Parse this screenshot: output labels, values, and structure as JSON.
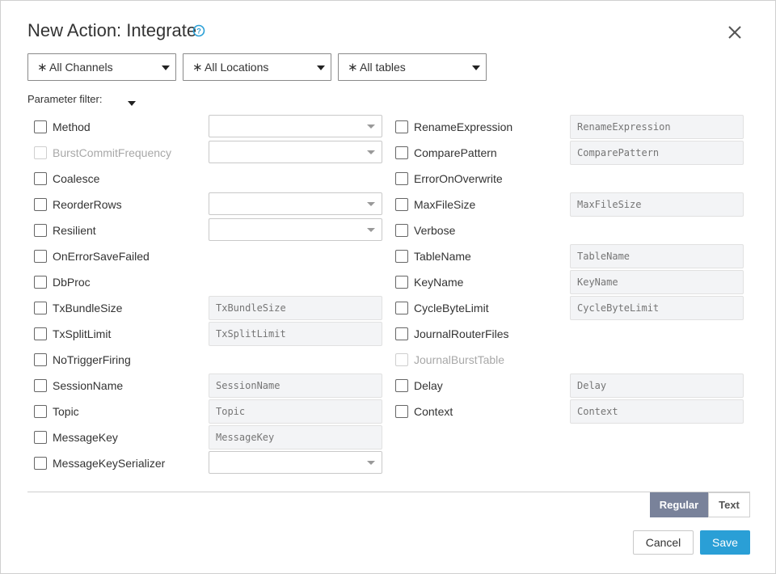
{
  "dialog": {
    "title": "New Action: Integrate",
    "help_icon": "help-circle-icon",
    "close_icon": "close-icon"
  },
  "filters": {
    "channels": "All Channels",
    "locations": "All Locations",
    "tables": "All tables",
    "star_glyph": "∗"
  },
  "parameter_filter": {
    "label": "Parameter filter:"
  },
  "left_params": [
    {
      "label": "Method",
      "control": "select",
      "disabled": false
    },
    {
      "label": "BurstCommitFrequency",
      "control": "select",
      "disabled": true
    },
    {
      "label": "Coalesce",
      "control": "none",
      "disabled": false
    },
    {
      "label": "ReorderRows",
      "control": "select",
      "disabled": false
    },
    {
      "label": "Resilient",
      "control": "select",
      "disabled": false
    },
    {
      "label": "OnErrorSaveFailed",
      "control": "none",
      "disabled": false
    },
    {
      "label": "DbProc",
      "control": "none",
      "disabled": false
    },
    {
      "label": "TxBundleSize",
      "control": "text",
      "placeholder": "TxBundleSize",
      "disabled": false
    },
    {
      "label": "TxSplitLimit",
      "control": "text",
      "placeholder": "TxSplitLimit",
      "disabled": false
    },
    {
      "label": "NoTriggerFiring",
      "control": "none",
      "disabled": false
    },
    {
      "label": "SessionName",
      "control": "text",
      "placeholder": "SessionName",
      "disabled": false
    },
    {
      "label": "Topic",
      "control": "text",
      "placeholder": "Topic",
      "disabled": false
    },
    {
      "label": "MessageKey",
      "control": "text",
      "placeholder": "MessageKey",
      "disabled": false
    },
    {
      "label": "MessageKeySerializer",
      "control": "select",
      "disabled": false
    }
  ],
  "right_params": [
    {
      "label": "RenameExpression",
      "control": "text",
      "placeholder": "RenameExpression",
      "disabled": false
    },
    {
      "label": "ComparePattern",
      "control": "text",
      "placeholder": "ComparePattern",
      "disabled": false
    },
    {
      "label": "ErrorOnOverwrite",
      "control": "none",
      "disabled": false
    },
    {
      "label": "MaxFileSize",
      "control": "text",
      "placeholder": "MaxFileSize",
      "disabled": false
    },
    {
      "label": "Verbose",
      "control": "none",
      "disabled": false
    },
    {
      "label": "TableName",
      "control": "text",
      "placeholder": "TableName",
      "disabled": false
    },
    {
      "label": "KeyName",
      "control": "text",
      "placeholder": "KeyName",
      "disabled": false
    },
    {
      "label": "CycleByteLimit",
      "control": "text",
      "placeholder": "CycleByteLimit",
      "disabled": false
    },
    {
      "label": "JournalRouterFiles",
      "control": "none",
      "disabled": false
    },
    {
      "label": "JournalBurstTable",
      "control": "none",
      "disabled": true
    },
    {
      "label": "Delay",
      "control": "text",
      "placeholder": "Delay",
      "disabled": false
    },
    {
      "label": "Context",
      "control": "text",
      "placeholder": "Context",
      "disabled": false
    }
  ],
  "mode_toggle": {
    "regular": "Regular",
    "text": "Text",
    "selected": "Regular"
  },
  "footer": {
    "cancel": "Cancel",
    "save": "Save"
  },
  "colors": {
    "accent": "#2a9fd6",
    "toggle_active": "#79829a",
    "help_icon": "#2a9fd6"
  }
}
